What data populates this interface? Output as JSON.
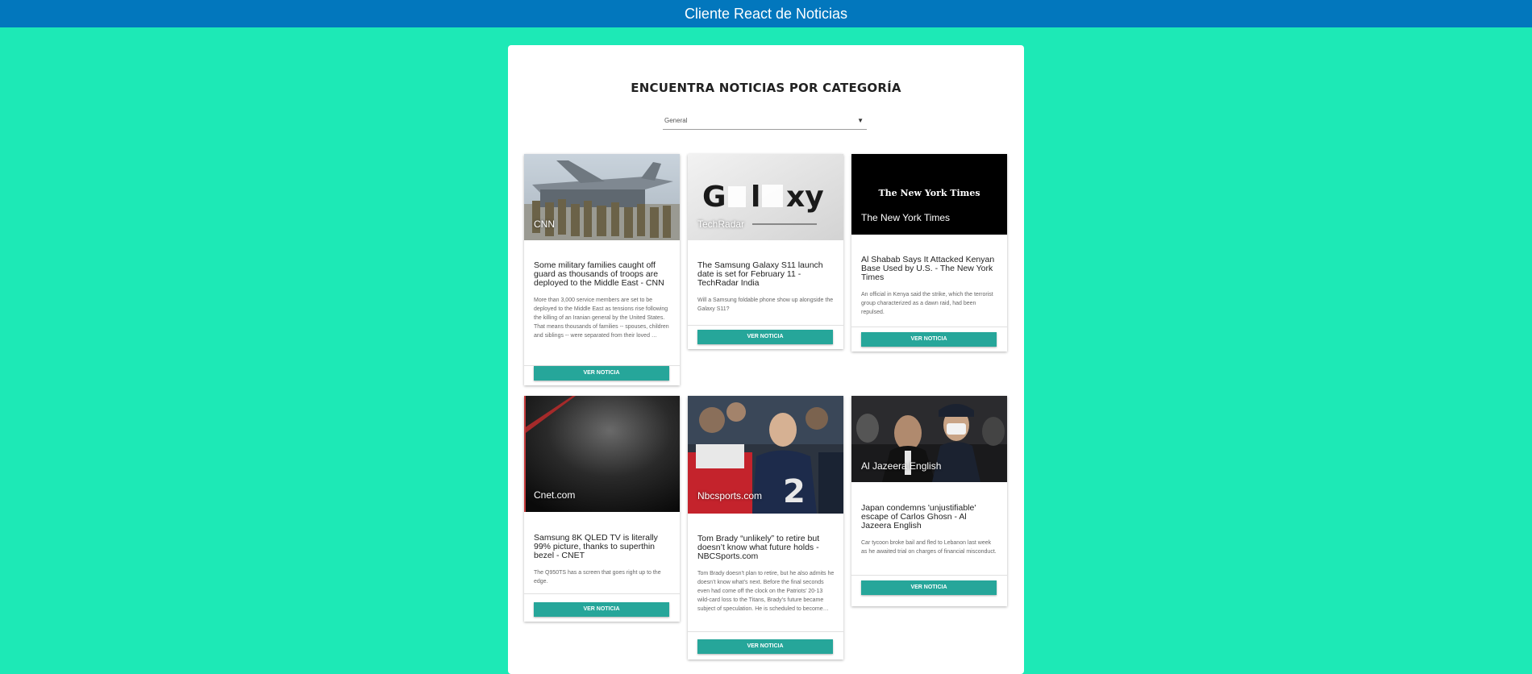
{
  "header": {
    "title": "Cliente React de Noticias"
  },
  "page": {
    "heading": "ENCUENTRA NOTICIAS POR CATEGORÍA"
  },
  "category_select": {
    "value": "General"
  },
  "colors": {
    "background": "#1de9b6",
    "topbar": "#0277bd",
    "button": "#26a69a"
  },
  "cards": [
    {
      "source": "CNN",
      "title": "Some military families caught off guard as thousands of troops are deployed to the Middle East - CNN",
      "description": "More than 3,000 service members are set to be deployed to the Middle East as tensions rise following the killing of an Iranian general by the United States. That means thousands of families -- spouses, children and siblings -- were separated from their loved …",
      "button": "VER NOTICIA"
    },
    {
      "source": "TechRadar",
      "title": "The Samsung Galaxy S11 launch date is set for February 11 - TechRadar India",
      "description": "Will a Samsung foldable phone show up alongside the Galaxy S11?",
      "button": "VER NOTICIA"
    },
    {
      "source": "The New York Times",
      "logo_text": "The New York Times",
      "title": "Al Shabab Says It Attacked Kenyan Base Used by U.S. - The New York Times",
      "description": "An official in Kenya said the strike, which the terrorist group characterized as a dawn raid, had been repulsed.",
      "button": "VER NOTICIA"
    },
    {
      "source": "Cnet.com",
      "title": "Samsung 8K QLED TV is literally 99% picture, thanks to superthin bezel - CNET",
      "description": "The Q950TS has a screen that goes right up to the edge.",
      "button": "VER NOTICIA"
    },
    {
      "source": "Nbcsports.com",
      "title": "Tom Brady “unlikely” to retire but doesn’t know what future holds - NBCSports.com",
      "description": "Tom Brady doesn’t plan to retire, but he also admits he doesn’t know what’s next. Before the final seconds even had come off the clock on the Patriots’ 20-13 wild-card loss to the Titans, Brady’s future became subject of speculation. He is scheduled to become…",
      "button": "VER NOTICIA"
    },
    {
      "source": "Al Jazeera English",
      "title": "Japan condemns 'unjustifiable' escape of Carlos Ghosn - Al Jazeera English",
      "description": "Car tycoon broke bail and fled to Lebanon last week as he awaited trial on charges of financial misconduct.",
      "button": "VER NOTICIA"
    }
  ]
}
